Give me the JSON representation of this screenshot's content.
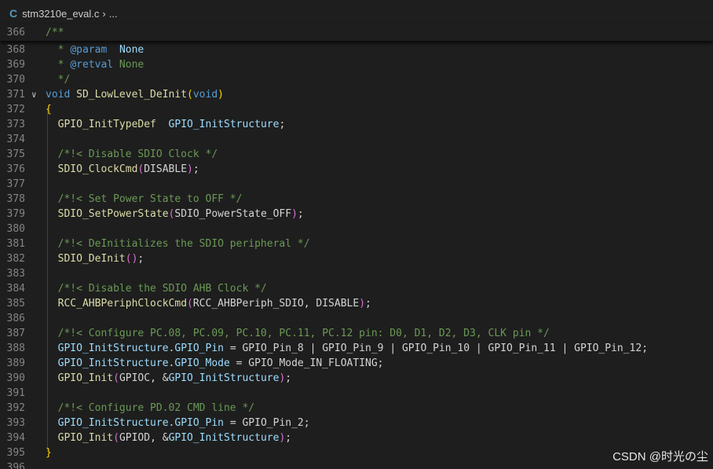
{
  "breadcrumb": {
    "file_icon": "C",
    "file": "stm3210e_eval.c",
    "separator": "›",
    "more": "..."
  },
  "sticky_line": {
    "number": "366",
    "text": "/**"
  },
  "lines": [
    {
      "n": "368",
      "tokens": [
        {
          "t": "  * ",
          "c": "cmt"
        },
        {
          "t": "@param",
          "c": "tag"
        },
        {
          "t": "  ",
          "c": "cmt"
        },
        {
          "t": "None",
          "c": "var"
        }
      ]
    },
    {
      "n": "369",
      "tokens": [
        {
          "t": "  * ",
          "c": "cmt"
        },
        {
          "t": "@retval",
          "c": "tag"
        },
        {
          "t": " None",
          "c": "cmt"
        }
      ]
    },
    {
      "n": "370",
      "tokens": [
        {
          "t": "  */",
          "c": "cmt"
        }
      ]
    },
    {
      "n": "371",
      "fold": true,
      "tokens": [
        {
          "t": "void",
          "c": "kw"
        },
        {
          "t": " ",
          "c": "txt"
        },
        {
          "t": "SD_LowLevel_DeInit",
          "c": "fn"
        },
        {
          "t": "(",
          "c": "br1"
        },
        {
          "t": "void",
          "c": "kw"
        },
        {
          "t": ")",
          "c": "br1"
        }
      ]
    },
    {
      "n": "372",
      "tokens": [
        {
          "t": "{",
          "c": "br1"
        }
      ]
    },
    {
      "n": "373",
      "tokens": [
        {
          "t": "  ",
          "c": "txt"
        },
        {
          "t": "GPIO_InitTypeDef",
          "c": "fn"
        },
        {
          "t": "  ",
          "c": "txt"
        },
        {
          "t": "GPIO_InitStructure",
          "c": "var"
        },
        {
          "t": ";",
          "c": "txt"
        }
      ]
    },
    {
      "n": "374",
      "tokens": []
    },
    {
      "n": "375",
      "tokens": [
        {
          "t": "  /*!< Disable SDIO Clock */",
          "c": "cmt"
        }
      ]
    },
    {
      "n": "376",
      "tokens": [
        {
          "t": "  ",
          "c": "txt"
        },
        {
          "t": "SDIO_ClockCmd",
          "c": "fn"
        },
        {
          "t": "(",
          "c": "br2"
        },
        {
          "t": "DISABLE",
          "c": "txt"
        },
        {
          "t": ")",
          "c": "br2"
        },
        {
          "t": ";",
          "c": "txt"
        }
      ]
    },
    {
      "n": "377",
      "tokens": []
    },
    {
      "n": "378",
      "tokens": [
        {
          "t": "  /*!< Set Power State to OFF */",
          "c": "cmt"
        }
      ]
    },
    {
      "n": "379",
      "tokens": [
        {
          "t": "  ",
          "c": "txt"
        },
        {
          "t": "SDIO_SetPowerState",
          "c": "fn"
        },
        {
          "t": "(",
          "c": "br2"
        },
        {
          "t": "SDIO_PowerState_OFF",
          "c": "txt"
        },
        {
          "t": ")",
          "c": "br2"
        },
        {
          "t": ";",
          "c": "txt"
        }
      ]
    },
    {
      "n": "380",
      "tokens": []
    },
    {
      "n": "381",
      "tokens": [
        {
          "t": "  /*!< DeInitializes the SDIO peripheral */",
          "c": "cmt"
        }
      ]
    },
    {
      "n": "382",
      "tokens": [
        {
          "t": "  ",
          "c": "txt"
        },
        {
          "t": "SDIO_DeInit",
          "c": "fn"
        },
        {
          "t": "()",
          "c": "br2"
        },
        {
          "t": ";",
          "c": "txt"
        }
      ]
    },
    {
      "n": "383",
      "tokens": []
    },
    {
      "n": "384",
      "tokens": [
        {
          "t": "  /*!< Disable the SDIO AHB Clock */",
          "c": "cmt"
        }
      ]
    },
    {
      "n": "385",
      "tokens": [
        {
          "t": "  ",
          "c": "txt"
        },
        {
          "t": "RCC_AHBPeriphClockCmd",
          "c": "fn"
        },
        {
          "t": "(",
          "c": "br2"
        },
        {
          "t": "RCC_AHBPeriph_SDIO, DISABLE",
          "c": "txt"
        },
        {
          "t": ")",
          "c": "br2"
        },
        {
          "t": ";",
          "c": "txt"
        }
      ]
    },
    {
      "n": "386",
      "tokens": []
    },
    {
      "n": "387",
      "tokens": [
        {
          "t": "  /*!< Configure PC.08, PC.09, PC.10, PC.11, PC.12 pin: D0, D1, D2, D3, CLK pin */",
          "c": "cmt"
        }
      ]
    },
    {
      "n": "388",
      "tokens": [
        {
          "t": "  ",
          "c": "txt"
        },
        {
          "t": "GPIO_InitStructure",
          "c": "var"
        },
        {
          "t": ".",
          "c": "txt"
        },
        {
          "t": "GPIO_Pin",
          "c": "var"
        },
        {
          "t": " = GPIO_Pin_8 | GPIO_Pin_9 | GPIO_Pin_10 | GPIO_Pin_11 | GPIO_Pin_12;",
          "c": "txt"
        }
      ]
    },
    {
      "n": "389",
      "tokens": [
        {
          "t": "  ",
          "c": "txt"
        },
        {
          "t": "GPIO_InitStructure",
          "c": "var"
        },
        {
          "t": ".",
          "c": "txt"
        },
        {
          "t": "GPIO_Mode",
          "c": "var"
        },
        {
          "t": " = GPIO_Mode_IN_FLOATING;",
          "c": "txt"
        }
      ]
    },
    {
      "n": "390",
      "tokens": [
        {
          "t": "  ",
          "c": "txt"
        },
        {
          "t": "GPIO_Init",
          "c": "fn"
        },
        {
          "t": "(",
          "c": "br2"
        },
        {
          "t": "GPIOC, &",
          "c": "txt"
        },
        {
          "t": "GPIO_InitStructure",
          "c": "var"
        },
        {
          "t": ")",
          "c": "br2"
        },
        {
          "t": ";",
          "c": "txt"
        }
      ]
    },
    {
      "n": "391",
      "tokens": []
    },
    {
      "n": "392",
      "tokens": [
        {
          "t": "  /*!< Configure PD.02 CMD line */",
          "c": "cmt"
        }
      ]
    },
    {
      "n": "393",
      "tokens": [
        {
          "t": "  ",
          "c": "txt"
        },
        {
          "t": "GPIO_InitStructure",
          "c": "var"
        },
        {
          "t": ".",
          "c": "txt"
        },
        {
          "t": "GPIO_Pin",
          "c": "var"
        },
        {
          "t": " = GPIO_Pin_2;",
          "c": "txt"
        }
      ]
    },
    {
      "n": "394",
      "tokens": [
        {
          "t": "  ",
          "c": "txt"
        },
        {
          "t": "GPIO_Init",
          "c": "fn"
        },
        {
          "t": "(",
          "c": "br2"
        },
        {
          "t": "GPIOD, &",
          "c": "txt"
        },
        {
          "t": "GPIO_InitStructure",
          "c": "var"
        },
        {
          "t": ")",
          "c": "br2"
        },
        {
          "t": ";",
          "c": "txt"
        }
      ]
    },
    {
      "n": "395",
      "tokens": [
        {
          "t": "}",
          "c": "br1"
        }
      ]
    },
    {
      "n": "396",
      "tokens": []
    }
  ],
  "watermark": "CSDN @时光の尘"
}
